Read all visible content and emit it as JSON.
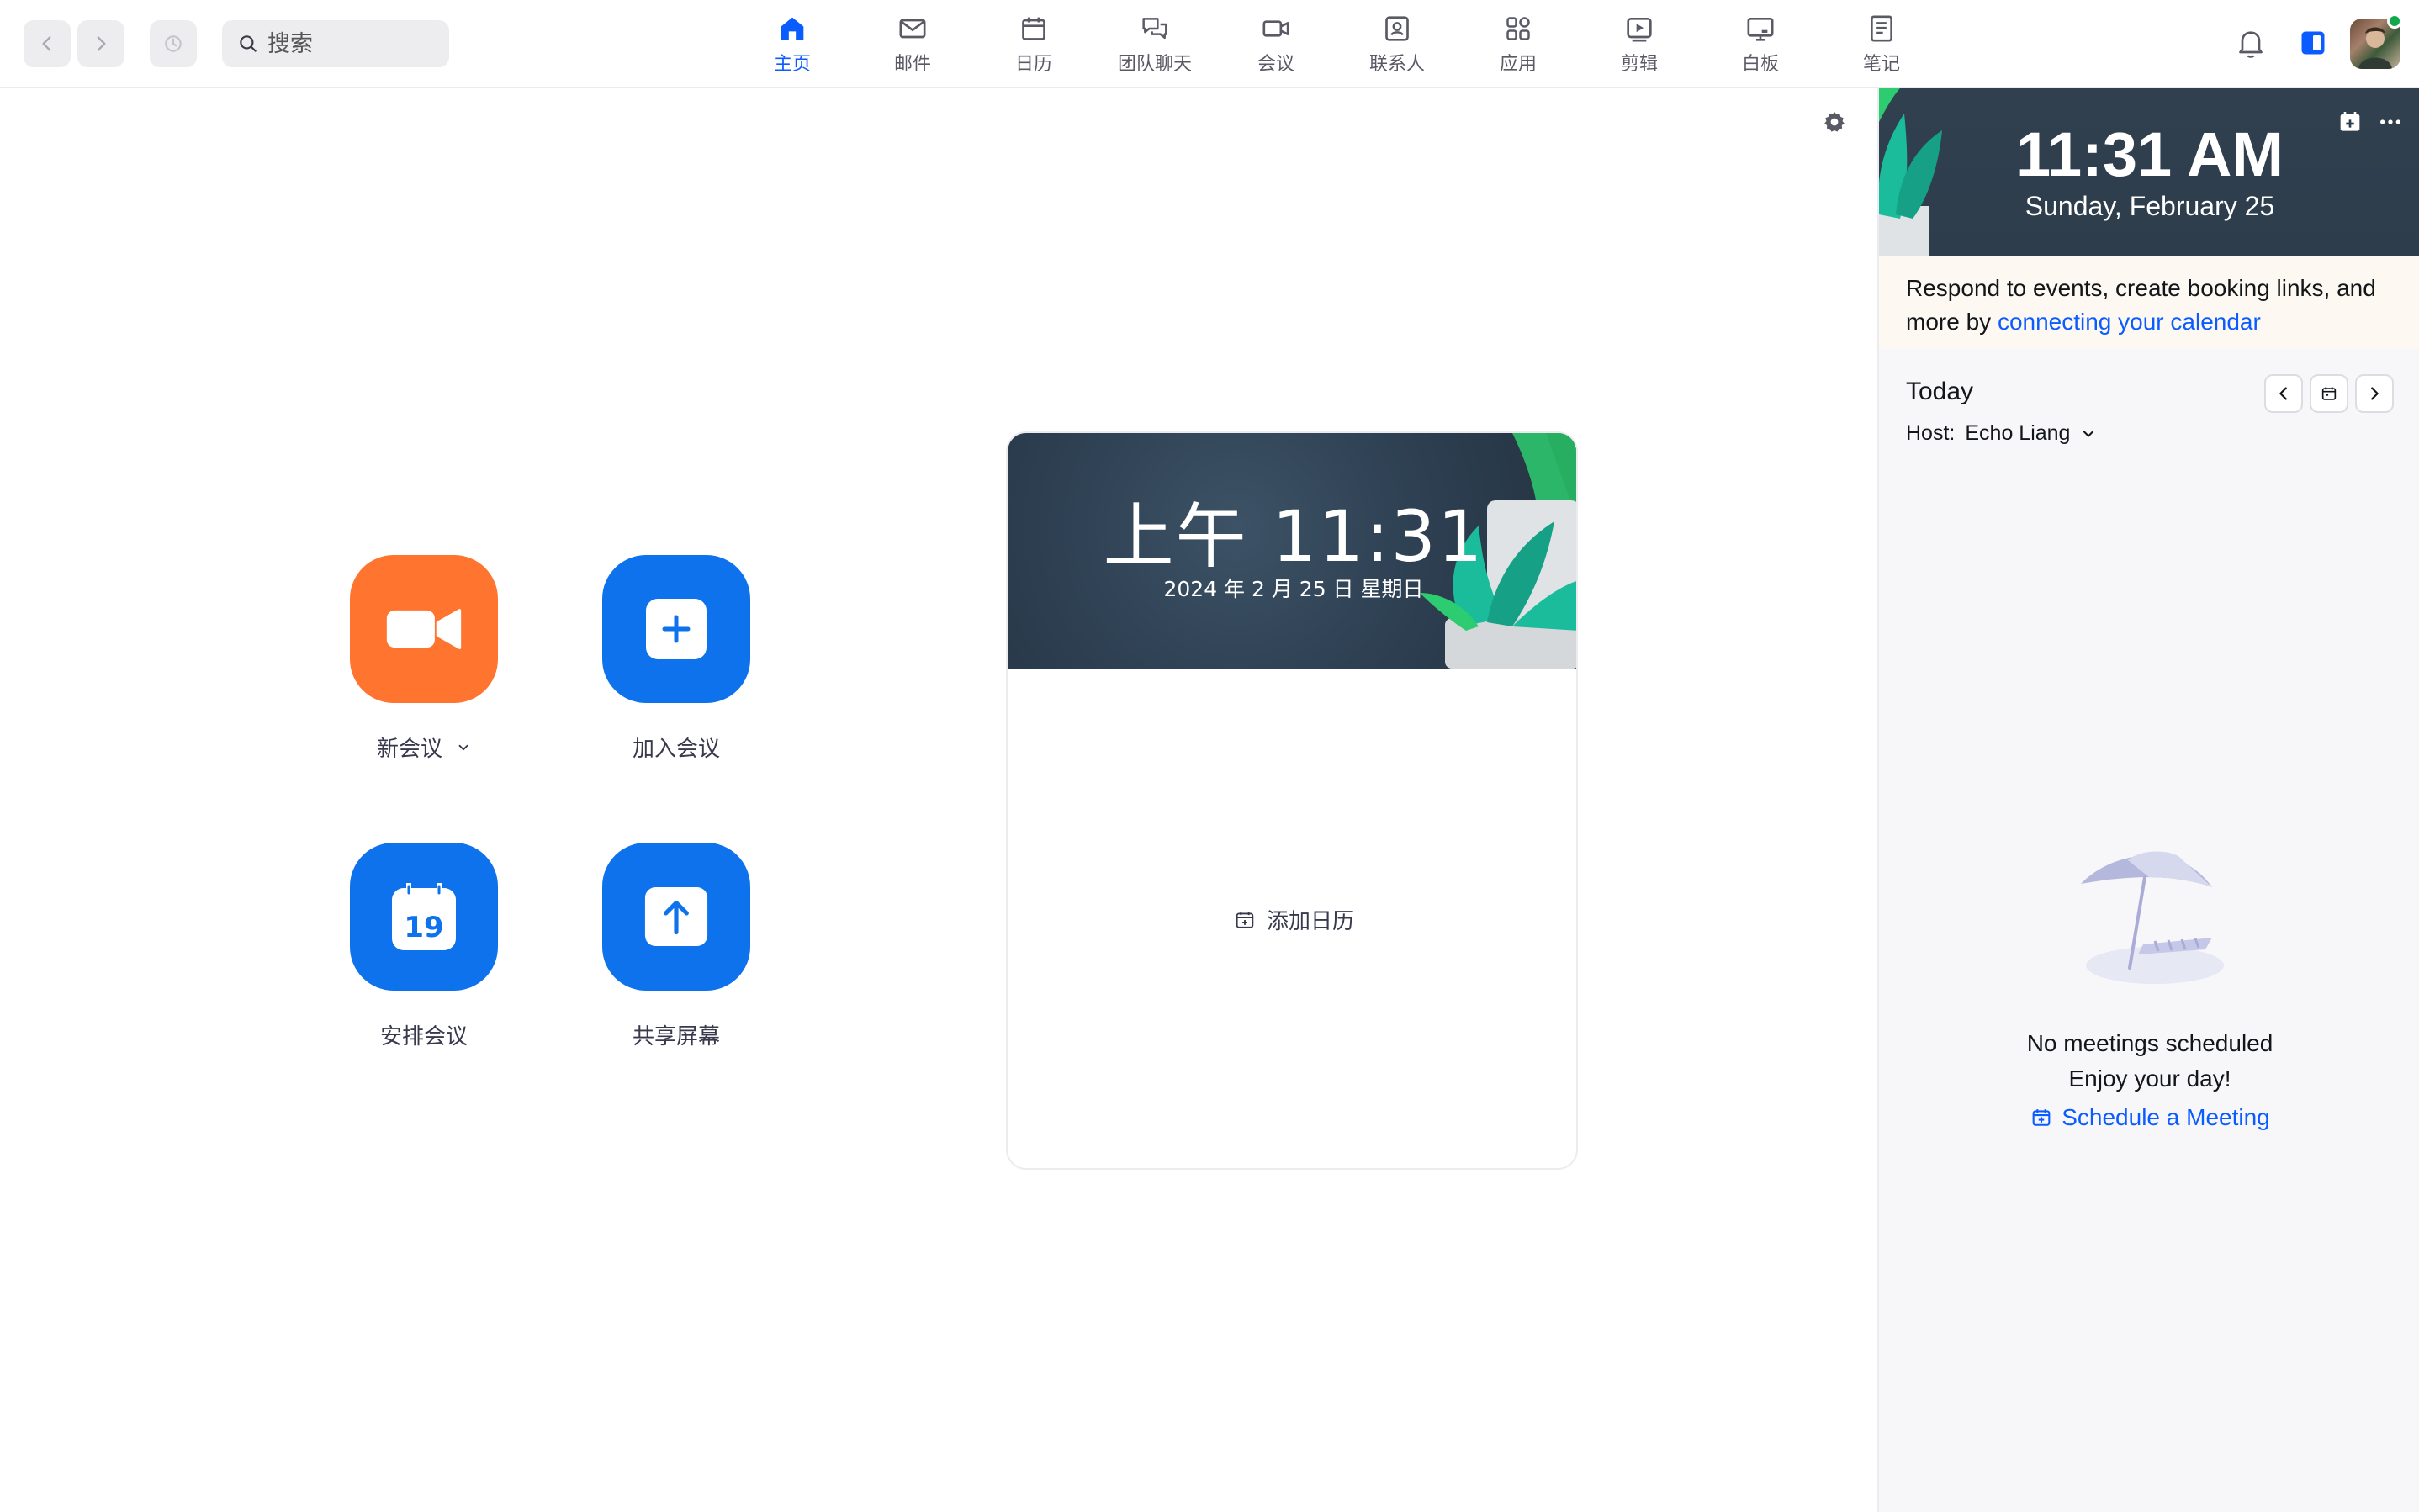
{
  "search": {
    "placeholder": "搜索"
  },
  "nav": {
    "tabs": [
      {
        "label": "主页",
        "icon": "home-icon",
        "active": true
      },
      {
        "label": "邮件",
        "icon": "mail-icon"
      },
      {
        "label": "日历",
        "icon": "calendar-icon"
      },
      {
        "label": "团队聊天",
        "icon": "chat-icon"
      },
      {
        "label": "会议",
        "icon": "video-icon"
      },
      {
        "label": "联系人",
        "icon": "contacts-icon"
      },
      {
        "label": "应用",
        "icon": "apps-icon"
      },
      {
        "label": "剪辑",
        "icon": "clips-icon"
      },
      {
        "label": "白板",
        "icon": "whiteboard-icon"
      },
      {
        "label": "笔记",
        "icon": "notes-icon"
      }
    ]
  },
  "actions": {
    "new_meeting": "新会议",
    "join_meeting": "加入会议",
    "schedule_meeting": "安排会议",
    "share_screen": "共享屏幕",
    "calendar_day": "19"
  },
  "clock_card": {
    "time": "上午 11:31",
    "date": "2024 年 2 月 25 日  星期日",
    "add_calendar": "添加日历"
  },
  "right_panel": {
    "time": "11:31 AM",
    "date": "Sunday, February 25",
    "connect_prefix": "Respond to events, create booking links, and more by ",
    "connect_link": "connecting your calendar",
    "today": "Today",
    "host_label": "Host:",
    "host_name": "Echo Liang",
    "empty_title": "No meetings scheduled",
    "empty_subtitle": "Enjoy your day!",
    "schedule_link": "Schedule a Meeting"
  },
  "colors": {
    "accent": "#0b5cff",
    "orange_tile": "#ff742e",
    "blue_tile": "#0e72ed",
    "presence": "#12a84c"
  }
}
